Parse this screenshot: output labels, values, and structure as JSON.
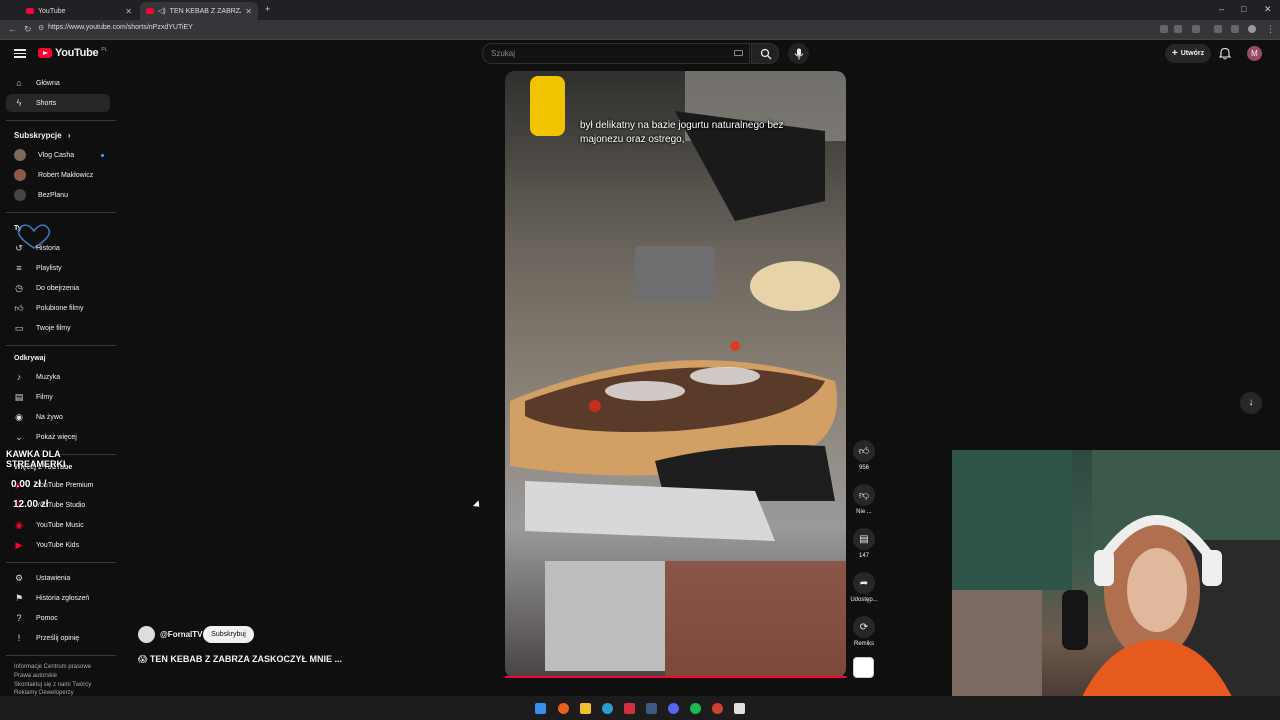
{
  "browser": {
    "tabs": [
      {
        "title": "YouTube"
      },
      {
        "title": "TEN KEBAB Z ZABRZA ZA"
      }
    ],
    "url": "https://www.youtube.com/shorts/nPzxdYUTiEY"
  },
  "header": {
    "logo_text": "YouTube",
    "logo_region": "PL",
    "search_placeholder": "Szukaj",
    "create_label": "Utwórz",
    "avatar_letter": "M"
  },
  "sidebar": {
    "main": [
      {
        "label": "Główna",
        "icon": "home-icon"
      },
      {
        "label": "Shorts",
        "icon": "shorts-icon"
      }
    ],
    "subscriptions_heading": "Subskrypcje",
    "subscriptions": [
      {
        "label": "Vlog Casha",
        "avatar_color": "#7a6a5a"
      },
      {
        "label": "Robert Makłowicz",
        "avatar_color": "#8a5a4a"
      },
      {
        "label": "BezPlanu",
        "avatar_color": "#444444"
      }
    ],
    "you_heading": "Ty",
    "you": [
      {
        "label": "Historia",
        "icon": "history-icon"
      },
      {
        "label": "Playlisty",
        "icon": "playlist-icon"
      },
      {
        "label": "Do obejrzenia",
        "icon": "clock-icon"
      },
      {
        "label": "Polubione filmy",
        "icon": "thumb-up-icon"
      },
      {
        "label": "Twoje filmy",
        "icon": "video-icon"
      }
    ],
    "explore_heading": "Odkrywaj",
    "explore": [
      {
        "label": "Muzyka",
        "icon": "music-icon"
      },
      {
        "label": "Filmy",
        "icon": "film-icon"
      },
      {
        "label": "Na żywo",
        "icon": "live-icon"
      },
      {
        "label": "Pokaż więcej",
        "icon": "chevron-down-icon"
      }
    ],
    "more_heading": "Więcej z YouTube",
    "more": [
      {
        "label": "YouTube Premium",
        "color": "#ff0033"
      },
      {
        "label": "YouTube Studio",
        "color": "#ff0033"
      },
      {
        "label": "YouTube Music",
        "color": "#ff0033"
      },
      {
        "label": "YouTube Kids",
        "color": "#ff0033"
      }
    ],
    "settings": [
      {
        "label": "Ustawienia",
        "icon": "gear-icon"
      },
      {
        "label": "Historia zgłoszeń",
        "icon": "flag-icon"
      },
      {
        "label": "Pomoc",
        "icon": "help-icon"
      },
      {
        "label": "Prześlij opinię",
        "icon": "feedback-icon"
      }
    ],
    "footer": {
      "line1": "Informacje  Centrum prasowe",
      "line2": "Prawa autorskie",
      "line3": "Skontaktuj się z nami  Twórcy",
      "line4": "Reklamy  Deweloperzy"
    }
  },
  "overlay": {
    "title": "KAWKA DLA STREAMERKI",
    "amount_line1": "0.00 zł /",
    "amount_line2": "12.00 zł"
  },
  "short": {
    "caption": "był delikatny na bazie jogurtu naturalnego bez majonezu oraz ostrego,",
    "channel": "@FornalTV",
    "subscribe_label": "Subskrybuj",
    "title": "😱 TEN KEBAB Z ZABRZA ZASKOCZYŁ MNIE ...",
    "actions": {
      "likes": "956",
      "dislike_label": "Nie ...",
      "comments": "147",
      "share_label": "Udostęp...",
      "remix_label": "Remiks"
    }
  }
}
